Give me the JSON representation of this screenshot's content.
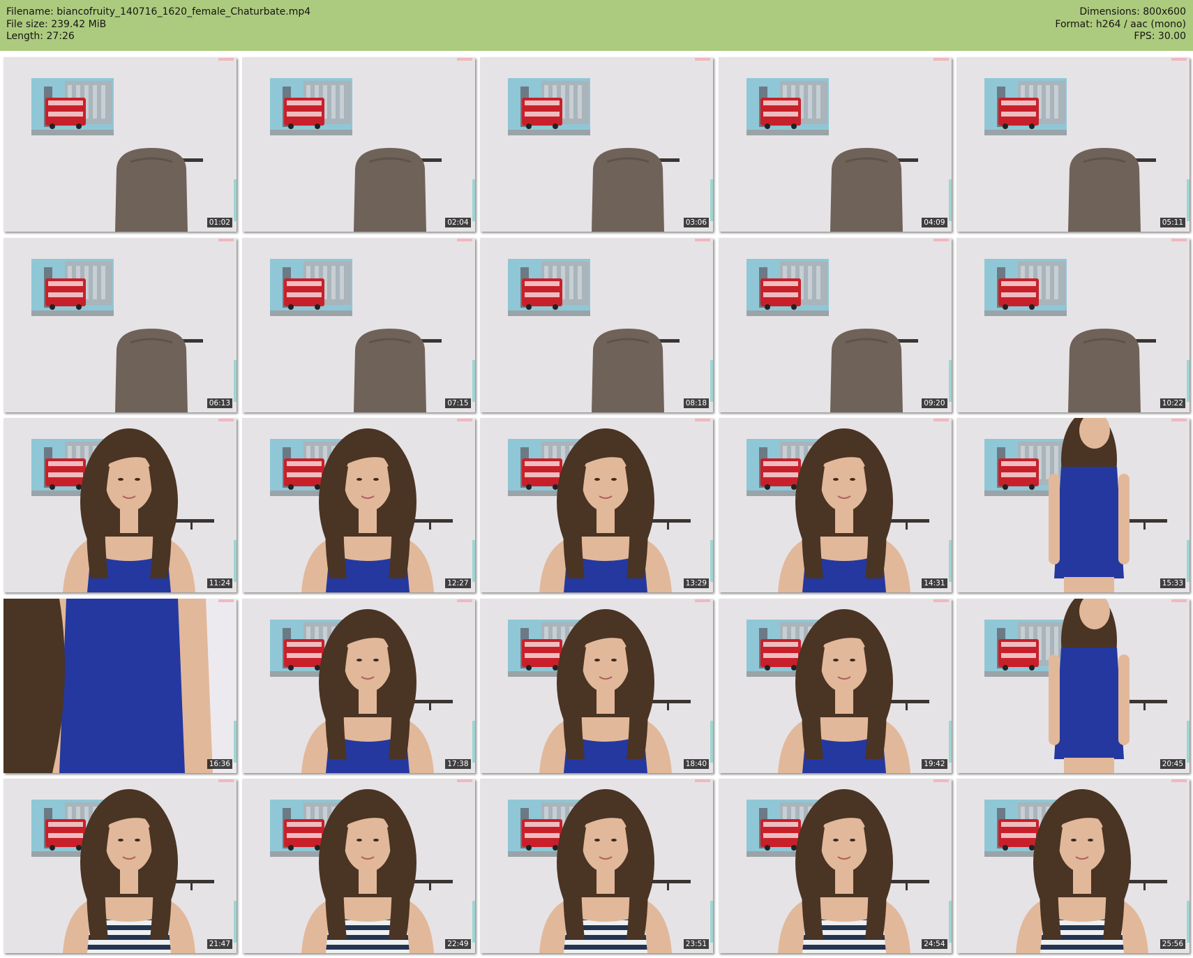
{
  "header": {
    "left_lines": [
      "Filename: biancofruity_140716_1620_female_Chaturbate.mp4",
      "File size: 239.42 MiB",
      "Length: 27:26"
    ],
    "right_lines": [
      "Dimensions: 800x600",
      "Format: h264 / aac (mono)",
      "FPS: 30.00"
    ]
  },
  "colors": {
    "header_bg": "#adcb7e",
    "wall": "#e6e3e6",
    "chair": "#6f6259",
    "poster_sky": "#8fc7d6",
    "bus_red": "#c8202a",
    "dress_blue": "#2438a0",
    "hair": "#4a3424",
    "skin": "#e2b89a",
    "stripe_navy": "#243450"
  },
  "thumbnails": [
    {
      "time": "01:02",
      "scene": "chair"
    },
    {
      "time": "02:04",
      "scene": "chair"
    },
    {
      "time": "03:06",
      "scene": "chair"
    },
    {
      "time": "04:09",
      "scene": "chair"
    },
    {
      "time": "05:11",
      "scene": "chair"
    },
    {
      "time": "06:13",
      "scene": "chair"
    },
    {
      "time": "07:15",
      "scene": "chair"
    },
    {
      "time": "08:18",
      "scene": "chair"
    },
    {
      "time": "09:20",
      "scene": "chair"
    },
    {
      "time": "10:22",
      "scene": "chair"
    },
    {
      "time": "11:24",
      "scene": "person-blue"
    },
    {
      "time": "12:27",
      "scene": "person-blue"
    },
    {
      "time": "13:29",
      "scene": "person-blue"
    },
    {
      "time": "14:31",
      "scene": "person-blue"
    },
    {
      "time": "15:33",
      "scene": "standing-blue"
    },
    {
      "time": "16:36",
      "scene": "closeup-blue"
    },
    {
      "time": "17:38",
      "scene": "person-blue"
    },
    {
      "time": "18:40",
      "scene": "person-blue"
    },
    {
      "time": "19:42",
      "scene": "person-blue"
    },
    {
      "time": "20:45",
      "scene": "standing-blue"
    },
    {
      "time": "21:47",
      "scene": "person-striped"
    },
    {
      "time": "22:49",
      "scene": "person-striped"
    },
    {
      "time": "23:51",
      "scene": "person-striped"
    },
    {
      "time": "24:54",
      "scene": "person-striped"
    },
    {
      "time": "25:56",
      "scene": "person-striped"
    }
  ]
}
